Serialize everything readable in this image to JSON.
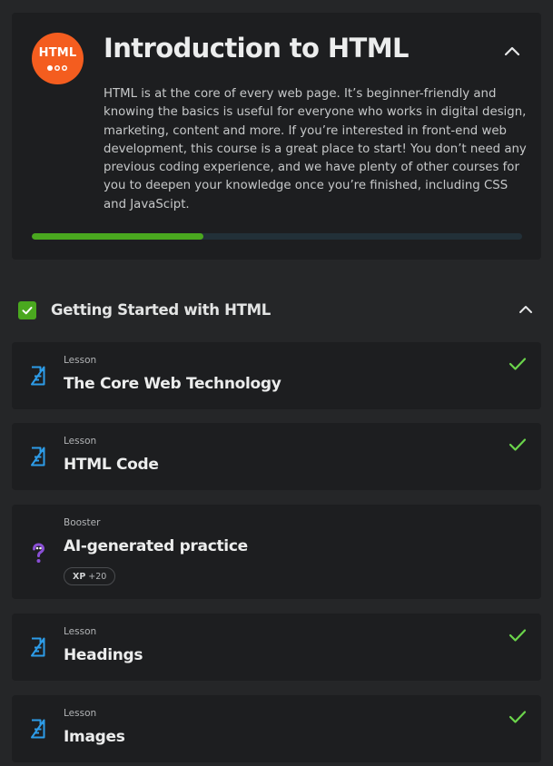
{
  "course": {
    "logo": {
      "text": "HTML",
      "icon": "html-course-logo",
      "color": "#f45d1f"
    },
    "title": "Introduction to HTML",
    "description": "HTML is at the core of every web page. It’s beginner-friendly and knowing the basics is useful for everyone who works in digital design, marketing, content and more. If you’re interested in front-end web development, this course is a great place to start! You don’t need any previous coding experience, and we have plenty of other courses for you to deepen your knowledge once you’re finished, including CSS and JavaScipt.",
    "progress_percent": 35,
    "collapse_icon": "chevron-up-icon"
  },
  "chapter": {
    "title": "Getting Started with HTML",
    "completed": true,
    "check_icon": "checkbox-checked-icon",
    "collapse_icon": "chevron-up-icon",
    "items": [
      {
        "type": "Lesson",
        "title": "The Core Web Technology",
        "icon": "lesson-document-icon",
        "completed": true
      },
      {
        "type": "Lesson",
        "title": "HTML Code",
        "icon": "lesson-document-icon",
        "completed": true
      },
      {
        "type": "Booster",
        "title": "AI-generated practice",
        "icon": "question-mark-icon",
        "completed": false,
        "xp_label": "XP",
        "xp_value": "+20"
      },
      {
        "type": "Lesson",
        "title": "Headings",
        "icon": "lesson-document-icon",
        "completed": true
      },
      {
        "type": "Lesson",
        "title": "Images",
        "icon": "lesson-document-icon",
        "completed": true
      }
    ]
  },
  "colors": {
    "accent_green": "#4aa81f",
    "check_green": "#6bd54b",
    "lesson_icon_blue": "#2d9ce8",
    "booster_purple": "#8a4fd6",
    "background": "#252628",
    "card": "#1d1e20"
  }
}
